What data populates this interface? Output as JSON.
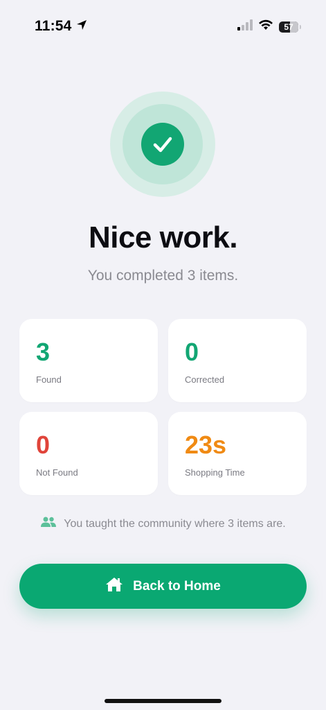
{
  "status_bar": {
    "time": "11:54",
    "battery": "57",
    "icons": [
      "location-arrow-icon",
      "cellular-signal-icon",
      "wifi-icon",
      "battery-icon"
    ]
  },
  "colors": {
    "accent": "#0aa872",
    "found": "#12a673",
    "corrected": "#12a673",
    "not_found": "#e0443a",
    "shopping_time": "#f08a13"
  },
  "hero": {
    "icon": "check-icon",
    "title": "Nice work.",
    "subtitle": "You completed 3 items."
  },
  "stats": [
    {
      "value": "3",
      "label": "Found",
      "color": "#12a673"
    },
    {
      "value": "0",
      "label": "Corrected",
      "color": "#12a673"
    },
    {
      "value": "0",
      "label": "Not Found",
      "color": "#e0443a"
    },
    {
      "value": "23s",
      "label": "Shopping Time",
      "color": "#f08a13"
    }
  ],
  "community": {
    "icon": "users-icon",
    "message": "You taught the community where 3 items are."
  },
  "actions": {
    "home_icon": "home-icon",
    "back_to_home_label": "Back to Home"
  }
}
